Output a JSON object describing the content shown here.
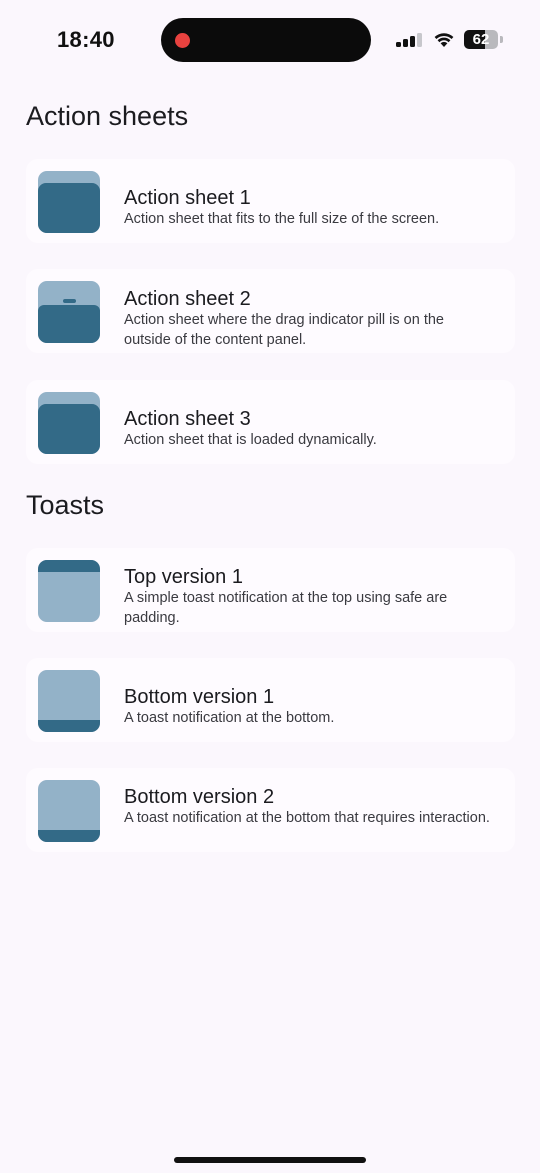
{
  "status_bar": {
    "time": "18:40",
    "battery_level": "62",
    "recording_indicator_color": "#e8423f"
  },
  "sections": [
    {
      "title": "Action sheets",
      "items": [
        {
          "title": "Action sheet 1",
          "description": "Action sheet that fits to the full size of the screen.",
          "thumbnail": "full-panel"
        },
        {
          "title": "Action sheet 2",
          "description": "Action sheet where the drag indicator pill is on the outside of the content panel.",
          "thumbnail": "outside-pill-panel"
        },
        {
          "title": "Action sheet 3",
          "description": "Action sheet that is loaded dynamically.",
          "thumbnail": "full-panel"
        }
      ]
    },
    {
      "title": "Toasts",
      "items": [
        {
          "title": "Top version 1",
          "description": "A simple toast notification at the top using safe are padding.",
          "thumbnail": "top-toast"
        },
        {
          "title": "Bottom version 1",
          "description": "A toast notification at the bottom.",
          "thumbnail": "bottom-toast"
        },
        {
          "title": "Bottom version 2",
          "description": "A toast notification at the bottom that requires interaction.",
          "thumbnail": "bottom-toast"
        }
      ]
    }
  ],
  "colors": {
    "background": "#fbf7fd",
    "card": "#fefbff",
    "thumbnail_light": "#93b2c8",
    "thumbnail_dark": "#336a87"
  }
}
